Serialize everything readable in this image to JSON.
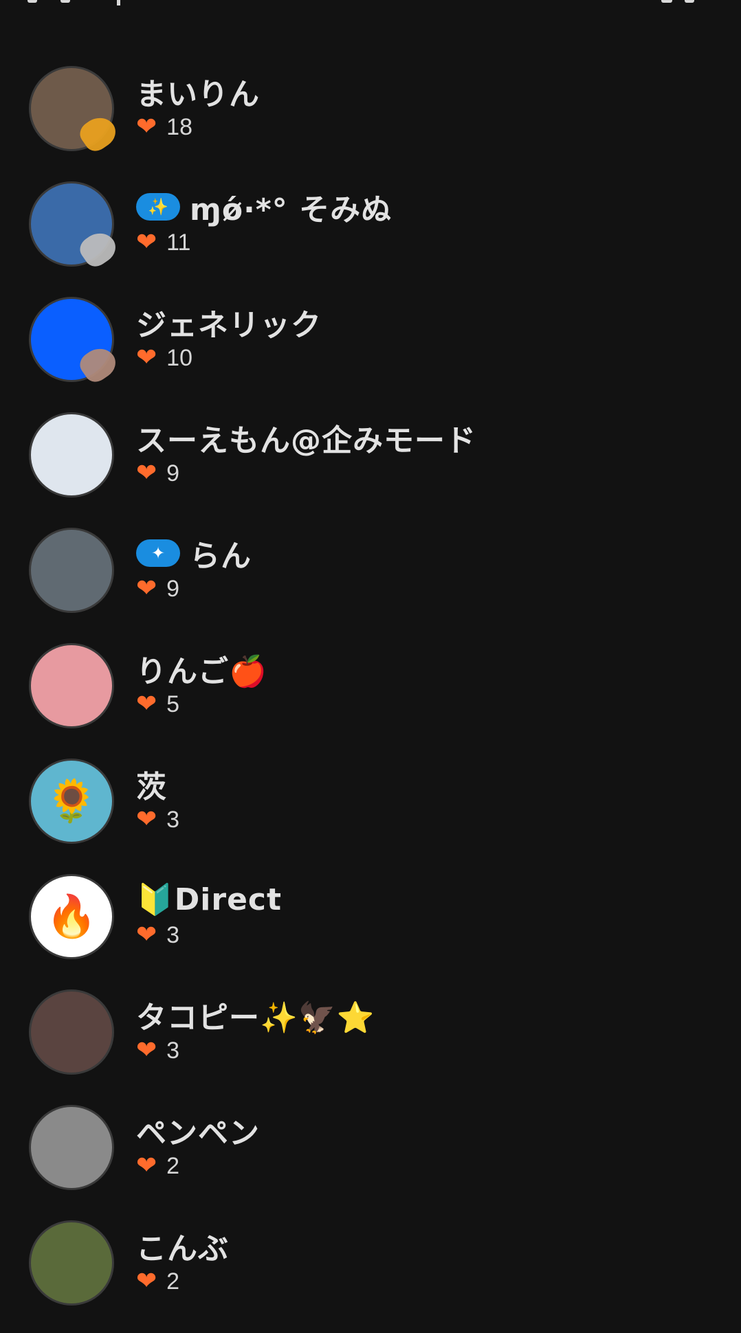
{
  "supporters": [
    {
      "name": "まいりん",
      "count": "18",
      "pill": "",
      "avatar": {
        "bg": "#6e5a4a",
        "glyph": "",
        "badge": "#e8a01f"
      }
    },
    {
      "name": "ɱǿ·*° そみぬ",
      "count": "11",
      "pill": "✨",
      "avatar": {
        "bg": "#3a6aa8",
        "glyph": "",
        "badge": "#bcbcbc"
      }
    },
    {
      "name": "ジェネリック",
      "count": "10",
      "pill": "",
      "avatar": {
        "bg": "#0a5fff",
        "glyph": "",
        "badge": "#b08a7a"
      }
    },
    {
      "name": "スーえもん@企みモード",
      "count": "9",
      "pill": "",
      "avatar": {
        "bg": "#dfe6ee",
        "glyph": "",
        "badge": ""
      }
    },
    {
      "name": "らん",
      "count": "9",
      "pill": "✦",
      "avatar": {
        "bg": "#606a72",
        "glyph": "",
        "badge": ""
      }
    },
    {
      "name": "りんご🍎",
      "count": "5",
      "pill": "",
      "avatar": {
        "bg": "#e79aa0",
        "glyph": "",
        "badge": ""
      }
    },
    {
      "name": "茨",
      "count": "3",
      "pill": "",
      "avatar": {
        "bg": "#5fb6cf",
        "glyph": "🌻",
        "badge": ""
      }
    },
    {
      "name": "🔰Direct",
      "count": "3",
      "pill": "",
      "avatar": {
        "bg": "#ffffff",
        "glyph": "🔥",
        "badge": ""
      }
    },
    {
      "name": "タコピー✨🦅⭐",
      "count": "3",
      "pill": "",
      "avatar": {
        "bg": "#5a4440",
        "glyph": "",
        "badge": ""
      }
    },
    {
      "name": "ペンペン",
      "count": "2",
      "pill": "",
      "avatar": {
        "bg": "#8a8a8a",
        "glyph": "",
        "badge": ""
      }
    },
    {
      "name": "こんぶ",
      "count": "2",
      "pill": "",
      "avatar": {
        "bg": "#5a6a3a",
        "glyph": "",
        "badge": ""
      }
    }
  ],
  "icons": {
    "heart": "heart-icon"
  },
  "colors": {
    "background": "#121212",
    "heart": "#ff6b2c",
    "pill": "#1a8de0"
  }
}
